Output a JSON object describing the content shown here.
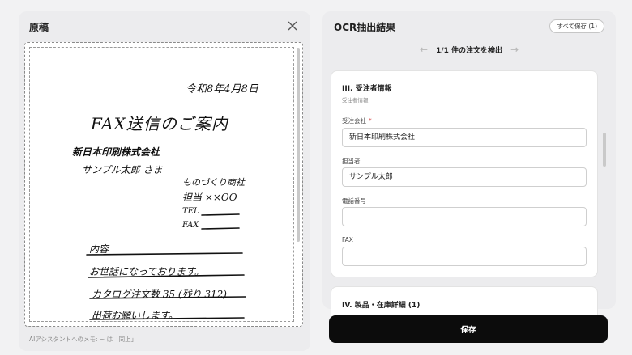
{
  "original_panel": {
    "title": "原稿",
    "note": "AIアシスタントへのメモ: ~ は「同上」",
    "document": {
      "date": "令和8年4月8日",
      "heading": "FAX送信のご案内",
      "recipient_company": "新日本印刷株式会社",
      "recipient_person": "サンプル太郎 さま",
      "sender_company": "ものづくり商社",
      "sender_person": "担当 ××OO",
      "tel_label": "TEL",
      "fax_label": "FAX",
      "content_label": "内容",
      "line1": "お世話になっております。",
      "line2": "カタログ注文数 35 (残り 312)",
      "line3": "出荷お願いします。"
    }
  },
  "ocr_panel": {
    "title": "OCR抽出結果",
    "save_all_label": "すべて保存 (1)",
    "pager_text": "1/1 件の注文を検出",
    "section": {
      "title": "III. 受注者情報",
      "subtitle": "受注者情報",
      "fields": [
        {
          "label": "受注会社",
          "required": "*",
          "value": "新日本印刷株式会社"
        },
        {
          "label": "担当者",
          "value": "サンプル太郎"
        },
        {
          "label": "電話番号",
          "value": ""
        },
        {
          "label": "FAX",
          "value": ""
        }
      ]
    },
    "next_section_title": "IV. 製品・在庫詳細 (1)"
  },
  "save_button_label": "保存",
  "icons": [
    "close-icon",
    "arrow-left-icon",
    "arrow-right-icon"
  ]
}
